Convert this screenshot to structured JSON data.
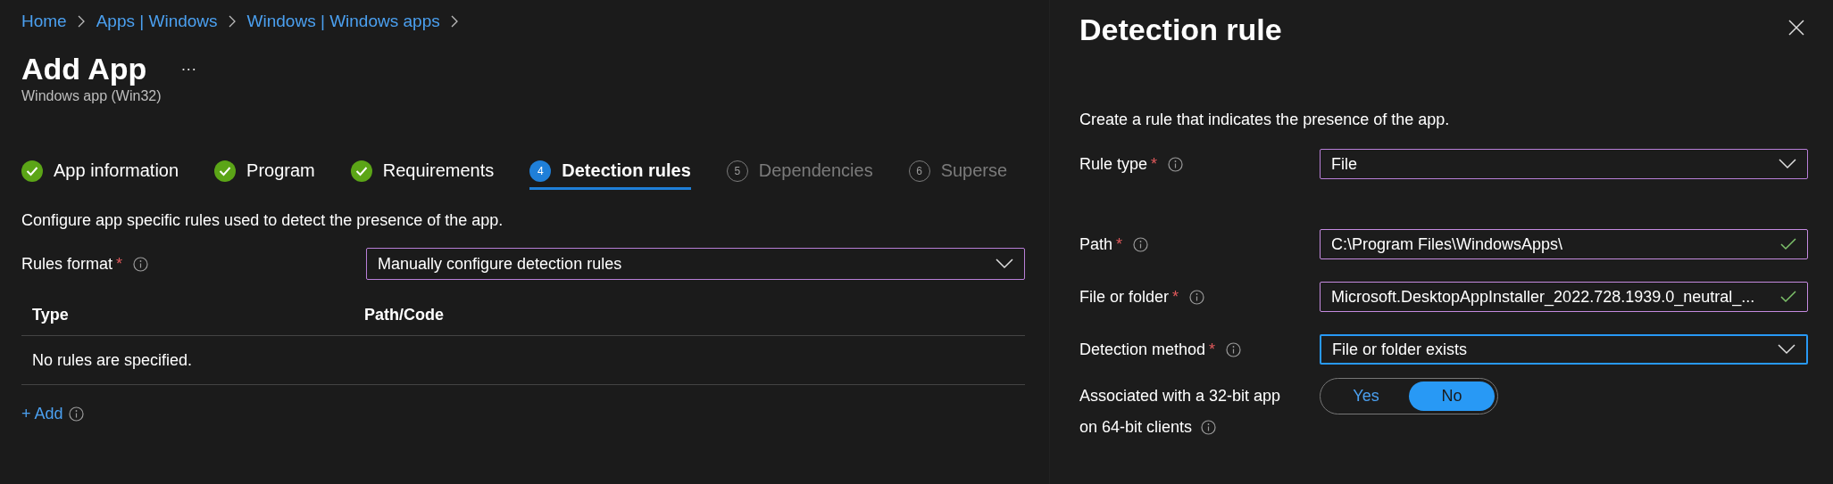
{
  "breadcrumb": [
    {
      "label": "Home"
    },
    {
      "label": "Apps | Windows"
    },
    {
      "label": "Windows | Windows apps"
    }
  ],
  "page": {
    "title": "Add App",
    "more": "···",
    "subtitle": "Windows app (Win32)"
  },
  "tabs": [
    {
      "label": "App information",
      "kind": "done",
      "selected": false
    },
    {
      "label": "Program",
      "kind": "done",
      "selected": false
    },
    {
      "label": "Requirements",
      "kind": "done",
      "selected": false
    },
    {
      "label": "Detection rules",
      "kind": "current",
      "number": "4",
      "selected": true
    },
    {
      "label": "Dependencies",
      "kind": "upcoming",
      "number": "5",
      "selected": false
    },
    {
      "label": "Superse",
      "kind": "upcoming",
      "number": "6",
      "selected": false
    }
  ],
  "description": "Configure app specific rules used to detect the presence of the app.",
  "rules_format": {
    "label": "Rules format",
    "required_mark": "*",
    "value": "Manually configure detection rules"
  },
  "table": {
    "columns": [
      "Type",
      "Path/Code"
    ],
    "empty_text": "No rules are specified."
  },
  "add_link": "+ Add",
  "panel": {
    "title": "Detection rule",
    "description": "Create a rule that indicates the presence of the app.",
    "fields": [
      {
        "label": "Rule type",
        "required_mark": "*",
        "kind": "dropdown",
        "value": "File",
        "focused": false
      },
      {
        "label": "Path",
        "required_mark": "*",
        "kind": "text",
        "value": "C:\\Program Files\\WindowsApps\\",
        "focused": false,
        "valid": true
      },
      {
        "label": "File or folder",
        "required_mark": "*",
        "kind": "text",
        "value": "Microsoft.DesktopAppInstaller_2022.728.1939.0_neutral_...",
        "focused": false,
        "valid": true
      },
      {
        "label": "Detection method",
        "required_mark": "*",
        "kind": "dropdown",
        "value": "File or folder exists",
        "focused": true
      }
    ],
    "toggle": {
      "label_lines": [
        "Associated with a 32-bit app",
        "on 64-bit clients"
      ],
      "options": [
        {
          "label": "Yes",
          "selected": false
        },
        {
          "label": "No",
          "selected": true
        }
      ]
    }
  }
}
